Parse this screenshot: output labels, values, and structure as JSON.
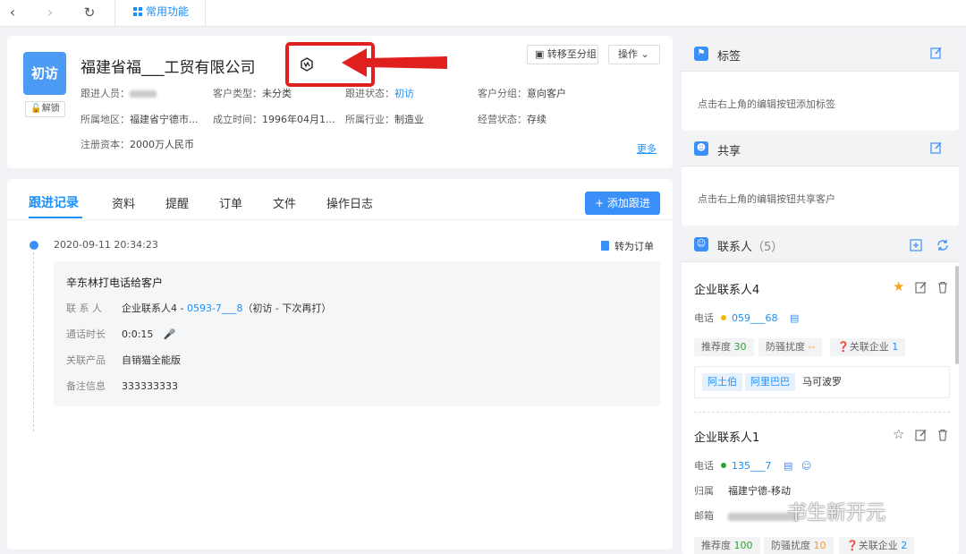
{
  "topbar": {
    "common_tab": "常用功能"
  },
  "customer": {
    "badge": "初访",
    "unlock": "解锁",
    "name": "福建省福___工贸有限公司",
    "move_group": "转移至分组",
    "operate": "操作",
    "fields": [
      {
        "label": "跟进人员：",
        "value": ""
      },
      {
        "label": "客户类型：",
        "value": "未分类"
      },
      {
        "label": "跟进状态：",
        "value": "初访"
      },
      {
        "label": "客户分组：",
        "value": "意向客户"
      },
      {
        "label": "所属地区：",
        "value": "福建省宁德市..."
      },
      {
        "label": "成立时间：",
        "value": "1996年04月1..."
      },
      {
        "label": "所属行业：",
        "value": "制造业"
      },
      {
        "label": "经营状态：",
        "value": "存续"
      },
      {
        "label": "注册资本：",
        "value": "2000万人民币"
      }
    ],
    "more": "更多"
  },
  "follow": {
    "tabs": [
      "跟进记录",
      "资料",
      "提醒",
      "订单",
      "文件",
      "操作日志"
    ],
    "add_button": "+ 添加跟进",
    "timestamp": "2020-09-11 20:34:23",
    "to_order": "转为订单",
    "record": {
      "title": "辛东林打电话给客户",
      "contact_label": "联 系 人",
      "contact_name": "企业联系人4 - ",
      "contact_phone": "0593-7___8",
      "contact_status": "（初访 - 下次再打）",
      "duration_label": "通话时长",
      "duration": "0:0:15",
      "product_label": "关联产品",
      "product": "自销猫全能版",
      "note_label": "备注信息",
      "note": "333333333"
    }
  },
  "sidebar": {
    "tags": {
      "title": "标签",
      "hint": "点击右上角的编辑按钮添加标签"
    },
    "share": {
      "title": "共享",
      "hint": "点击右上角的编辑按钮共享客户"
    },
    "contacts": {
      "title": "联系人",
      "count": "（5）",
      "items": [
        {
          "name": "企业联系人4",
          "phone_label": "电话",
          "phone": "059___68",
          "recommend": "推荐度",
          "recommend_val": "30",
          "spam": "防骚扰度",
          "spam_val": "--",
          "related": "关联企业",
          "related_val": "1",
          "tags": [
            "阿土伯",
            "阿里巴巴"
          ],
          "extra_tag": "马可波罗"
        },
        {
          "name": "企业联系人1",
          "phone_label": "电话",
          "phone": "135___7",
          "origin_label": "归属",
          "origin": "福建宁德-移动",
          "email_label": "邮箱",
          "recommend": "推荐度",
          "recommend_val": "100",
          "spam": "防骚扰度",
          "spam_val": "10",
          "related": "关联企业",
          "related_val": "2"
        }
      ]
    }
  },
  "watermark": "书生新开元",
  "colors": {
    "accent": "#1890ff",
    "badge": "#4b9bf5",
    "annotation": "#e0201f"
  }
}
